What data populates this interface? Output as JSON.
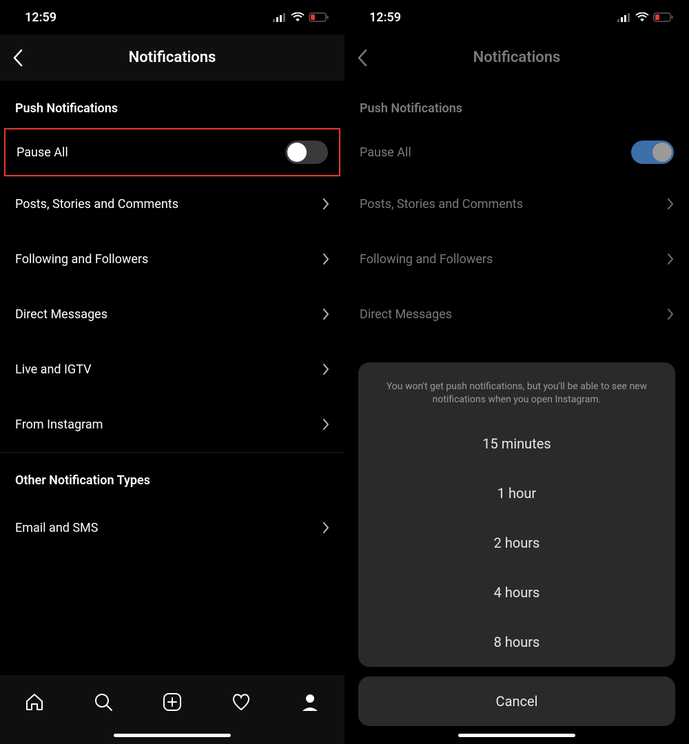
{
  "status": {
    "time": "12:59"
  },
  "left": {
    "header_title": "Notifications",
    "section1": "Push Notifications",
    "pause_all": "Pause All",
    "rows": [
      "Posts, Stories and Comments",
      "Following and Followers",
      "Direct Messages",
      "Live and IGTV",
      "From Instagram"
    ],
    "section2": "Other Notification Types",
    "email_sms": "Email and SMS"
  },
  "right": {
    "header_title": "Notifications",
    "section1": "Push Notifications",
    "pause_all": "Pause All",
    "rows": [
      "Posts, Stories and Comments",
      "Following and Followers",
      "Direct Messages"
    ],
    "sheet": {
      "message": "You won't get push notifications, but you'll be able to see new notifications when you open Instagram.",
      "options": [
        "15 minutes",
        "1 hour",
        "2 hours",
        "4 hours",
        "8 hours"
      ],
      "cancel": "Cancel"
    }
  }
}
